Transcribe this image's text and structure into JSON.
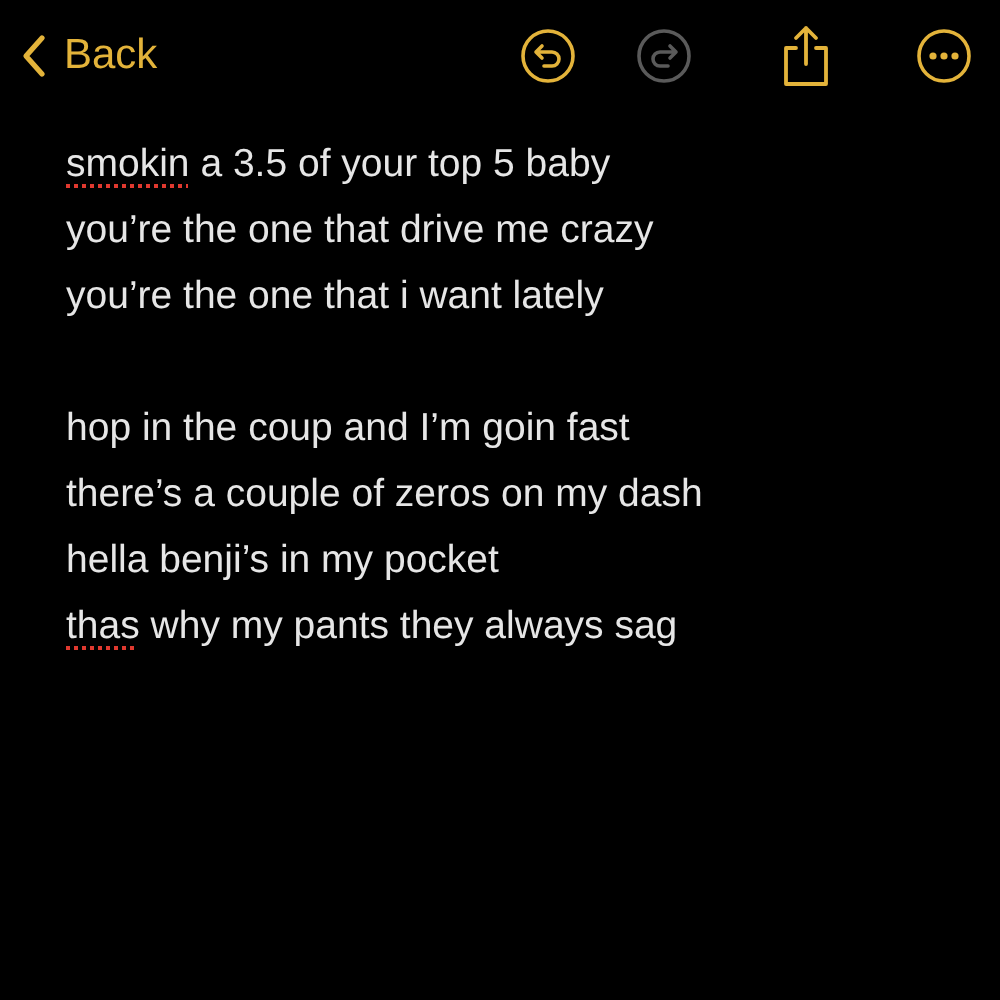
{
  "nav": {
    "back_label": "Back",
    "undo_disabled": false,
    "redo_disabled": true
  },
  "note": {
    "stanzas": [
      {
        "lines": [
          [
            {
              "text": "smokin",
              "misspelled": true
            },
            {
              "text": " a 3.5 of your top 5 baby",
              "misspelled": false
            }
          ],
          [
            {
              "text": "you’re the one that drive me crazy",
              "misspelled": false
            }
          ],
          [
            {
              "text": "you’re the one that i want lately",
              "misspelled": false
            }
          ]
        ]
      },
      {
        "lines": [
          [
            {
              "text": "hop in the coup and I’m goin fast",
              "misspelled": false
            }
          ],
          [
            {
              "text": "there’s a couple of zeros on my dash",
              "misspelled": false
            }
          ],
          [
            {
              "text": "hella benji’s in my pocket",
              "misspelled": false
            }
          ],
          [
            {
              "text": "thas",
              "misspelled": true
            },
            {
              "text": " why my pants they always sag",
              "misspelled": false
            }
          ]
        ]
      }
    ]
  }
}
